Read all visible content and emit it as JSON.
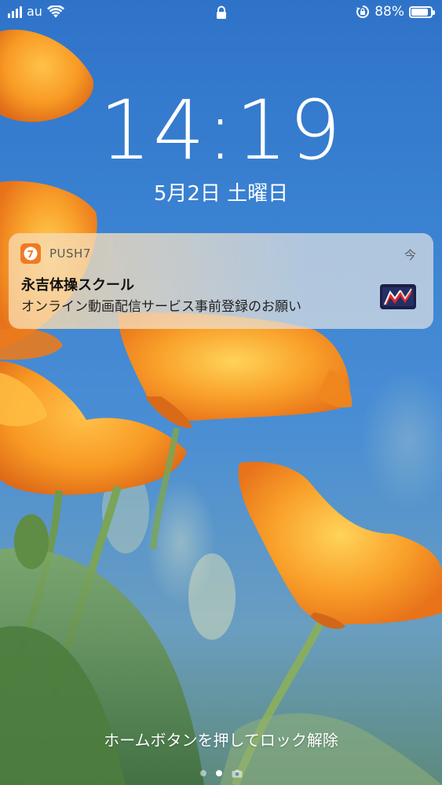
{
  "status_bar": {
    "carrier": "au",
    "battery_percent": "88%",
    "battery_level": 0.88,
    "signal_bars": 4
  },
  "lock_screen": {
    "time": "14:19",
    "date": "5月2日 土曜日"
  },
  "notification": {
    "app_name": "PUSH7",
    "time": "今",
    "title": "永吉体操スクール",
    "body": "オンライン動画配信サービス事前登録のお願い",
    "app_icon_glyph": "7"
  },
  "bottom": {
    "unlock_hint": "ホームボタンを押してロック解除",
    "pages": 2,
    "active_page": 1
  },
  "colors": {
    "app_icon": "#f07a22",
    "sky": "#3b83d2",
    "flower": "#f7a22b"
  }
}
